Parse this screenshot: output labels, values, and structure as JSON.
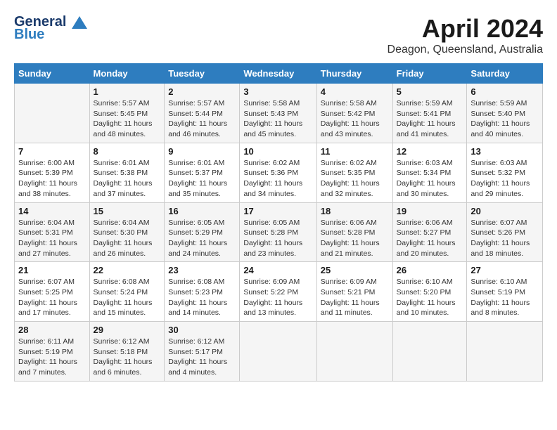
{
  "header": {
    "logo_line1": "General",
    "logo_line2": "Blue",
    "month_year": "April 2024",
    "location": "Deagon, Queensland, Australia"
  },
  "days_of_week": [
    "Sunday",
    "Monday",
    "Tuesday",
    "Wednesday",
    "Thursday",
    "Friday",
    "Saturday"
  ],
  "weeks": [
    [
      {
        "day": "",
        "info": ""
      },
      {
        "day": "1",
        "info": "Sunrise: 5:57 AM\nSunset: 5:45 PM\nDaylight: 11 hours\nand 48 minutes."
      },
      {
        "day": "2",
        "info": "Sunrise: 5:57 AM\nSunset: 5:44 PM\nDaylight: 11 hours\nand 46 minutes."
      },
      {
        "day": "3",
        "info": "Sunrise: 5:58 AM\nSunset: 5:43 PM\nDaylight: 11 hours\nand 45 minutes."
      },
      {
        "day": "4",
        "info": "Sunrise: 5:58 AM\nSunset: 5:42 PM\nDaylight: 11 hours\nand 43 minutes."
      },
      {
        "day": "5",
        "info": "Sunrise: 5:59 AM\nSunset: 5:41 PM\nDaylight: 11 hours\nand 41 minutes."
      },
      {
        "day": "6",
        "info": "Sunrise: 5:59 AM\nSunset: 5:40 PM\nDaylight: 11 hours\nand 40 minutes."
      }
    ],
    [
      {
        "day": "7",
        "info": "Sunrise: 6:00 AM\nSunset: 5:39 PM\nDaylight: 11 hours\nand 38 minutes."
      },
      {
        "day": "8",
        "info": "Sunrise: 6:01 AM\nSunset: 5:38 PM\nDaylight: 11 hours\nand 37 minutes."
      },
      {
        "day": "9",
        "info": "Sunrise: 6:01 AM\nSunset: 5:37 PM\nDaylight: 11 hours\nand 35 minutes."
      },
      {
        "day": "10",
        "info": "Sunrise: 6:02 AM\nSunset: 5:36 PM\nDaylight: 11 hours\nand 34 minutes."
      },
      {
        "day": "11",
        "info": "Sunrise: 6:02 AM\nSunset: 5:35 PM\nDaylight: 11 hours\nand 32 minutes."
      },
      {
        "day": "12",
        "info": "Sunrise: 6:03 AM\nSunset: 5:34 PM\nDaylight: 11 hours\nand 30 minutes."
      },
      {
        "day": "13",
        "info": "Sunrise: 6:03 AM\nSunset: 5:32 PM\nDaylight: 11 hours\nand 29 minutes."
      }
    ],
    [
      {
        "day": "14",
        "info": "Sunrise: 6:04 AM\nSunset: 5:31 PM\nDaylight: 11 hours\nand 27 minutes."
      },
      {
        "day": "15",
        "info": "Sunrise: 6:04 AM\nSunset: 5:30 PM\nDaylight: 11 hours\nand 26 minutes."
      },
      {
        "day": "16",
        "info": "Sunrise: 6:05 AM\nSunset: 5:29 PM\nDaylight: 11 hours\nand 24 minutes."
      },
      {
        "day": "17",
        "info": "Sunrise: 6:05 AM\nSunset: 5:28 PM\nDaylight: 11 hours\nand 23 minutes."
      },
      {
        "day": "18",
        "info": "Sunrise: 6:06 AM\nSunset: 5:28 PM\nDaylight: 11 hours\nand 21 minutes."
      },
      {
        "day": "19",
        "info": "Sunrise: 6:06 AM\nSunset: 5:27 PM\nDaylight: 11 hours\nand 20 minutes."
      },
      {
        "day": "20",
        "info": "Sunrise: 6:07 AM\nSunset: 5:26 PM\nDaylight: 11 hours\nand 18 minutes."
      }
    ],
    [
      {
        "day": "21",
        "info": "Sunrise: 6:07 AM\nSunset: 5:25 PM\nDaylight: 11 hours\nand 17 minutes."
      },
      {
        "day": "22",
        "info": "Sunrise: 6:08 AM\nSunset: 5:24 PM\nDaylight: 11 hours\nand 15 minutes."
      },
      {
        "day": "23",
        "info": "Sunrise: 6:08 AM\nSunset: 5:23 PM\nDaylight: 11 hours\nand 14 minutes."
      },
      {
        "day": "24",
        "info": "Sunrise: 6:09 AM\nSunset: 5:22 PM\nDaylight: 11 hours\nand 13 minutes."
      },
      {
        "day": "25",
        "info": "Sunrise: 6:09 AM\nSunset: 5:21 PM\nDaylight: 11 hours\nand 11 minutes."
      },
      {
        "day": "26",
        "info": "Sunrise: 6:10 AM\nSunset: 5:20 PM\nDaylight: 11 hours\nand 10 minutes."
      },
      {
        "day": "27",
        "info": "Sunrise: 6:10 AM\nSunset: 5:19 PM\nDaylight: 11 hours\nand 8 minutes."
      }
    ],
    [
      {
        "day": "28",
        "info": "Sunrise: 6:11 AM\nSunset: 5:19 PM\nDaylight: 11 hours\nand 7 minutes."
      },
      {
        "day": "29",
        "info": "Sunrise: 6:12 AM\nSunset: 5:18 PM\nDaylight: 11 hours\nand 6 minutes."
      },
      {
        "day": "30",
        "info": "Sunrise: 6:12 AM\nSunset: 5:17 PM\nDaylight: 11 hours\nand 4 minutes."
      },
      {
        "day": "",
        "info": ""
      },
      {
        "day": "",
        "info": ""
      },
      {
        "day": "",
        "info": ""
      },
      {
        "day": "",
        "info": ""
      }
    ]
  ]
}
